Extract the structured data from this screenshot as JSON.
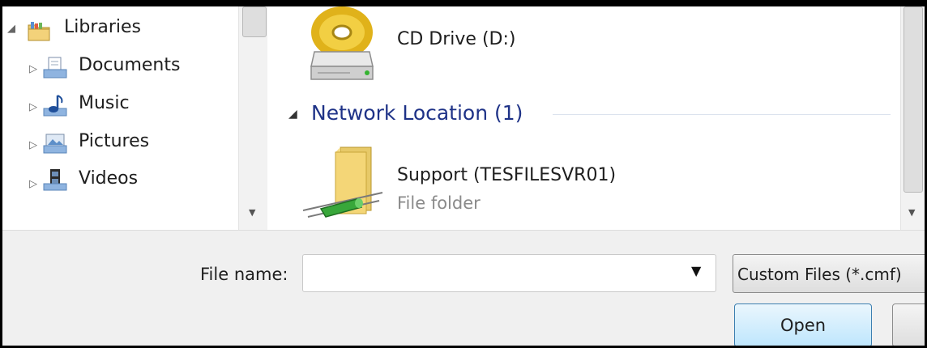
{
  "nav": {
    "items": [
      {
        "label": "Libraries",
        "icon": "libraries-icon",
        "expanded": true
      },
      {
        "label": "Documents",
        "icon": "documents-icon"
      },
      {
        "label": "Music",
        "icon": "music-icon"
      },
      {
        "label": "Pictures",
        "icon": "pictures-icon"
      },
      {
        "label": "Videos",
        "icon": "videos-icon"
      }
    ],
    "arrows": {
      "expanded": "◢",
      "collapsed": "▷"
    },
    "scroll_down": "▼"
  },
  "content": {
    "drive": {
      "name": "CD Drive (D:)",
      "icon": "cd-drive-icon"
    },
    "group": {
      "toggle": "◢",
      "header": "Network Location (1)"
    },
    "folder": {
      "name": "Support (TESFILESVR01)",
      "type": "File folder",
      "icon": "network-folder-icon"
    },
    "scroll_down": "▼"
  },
  "bottom": {
    "file_name_label": "File name:",
    "file_name_value": "",
    "dropdown_caret": "▼",
    "filter": "Custom Files (*.cmf)",
    "open_label": "Open"
  },
  "colors": {
    "group_header": "#1e3287",
    "open_button": "#bee6fd"
  }
}
